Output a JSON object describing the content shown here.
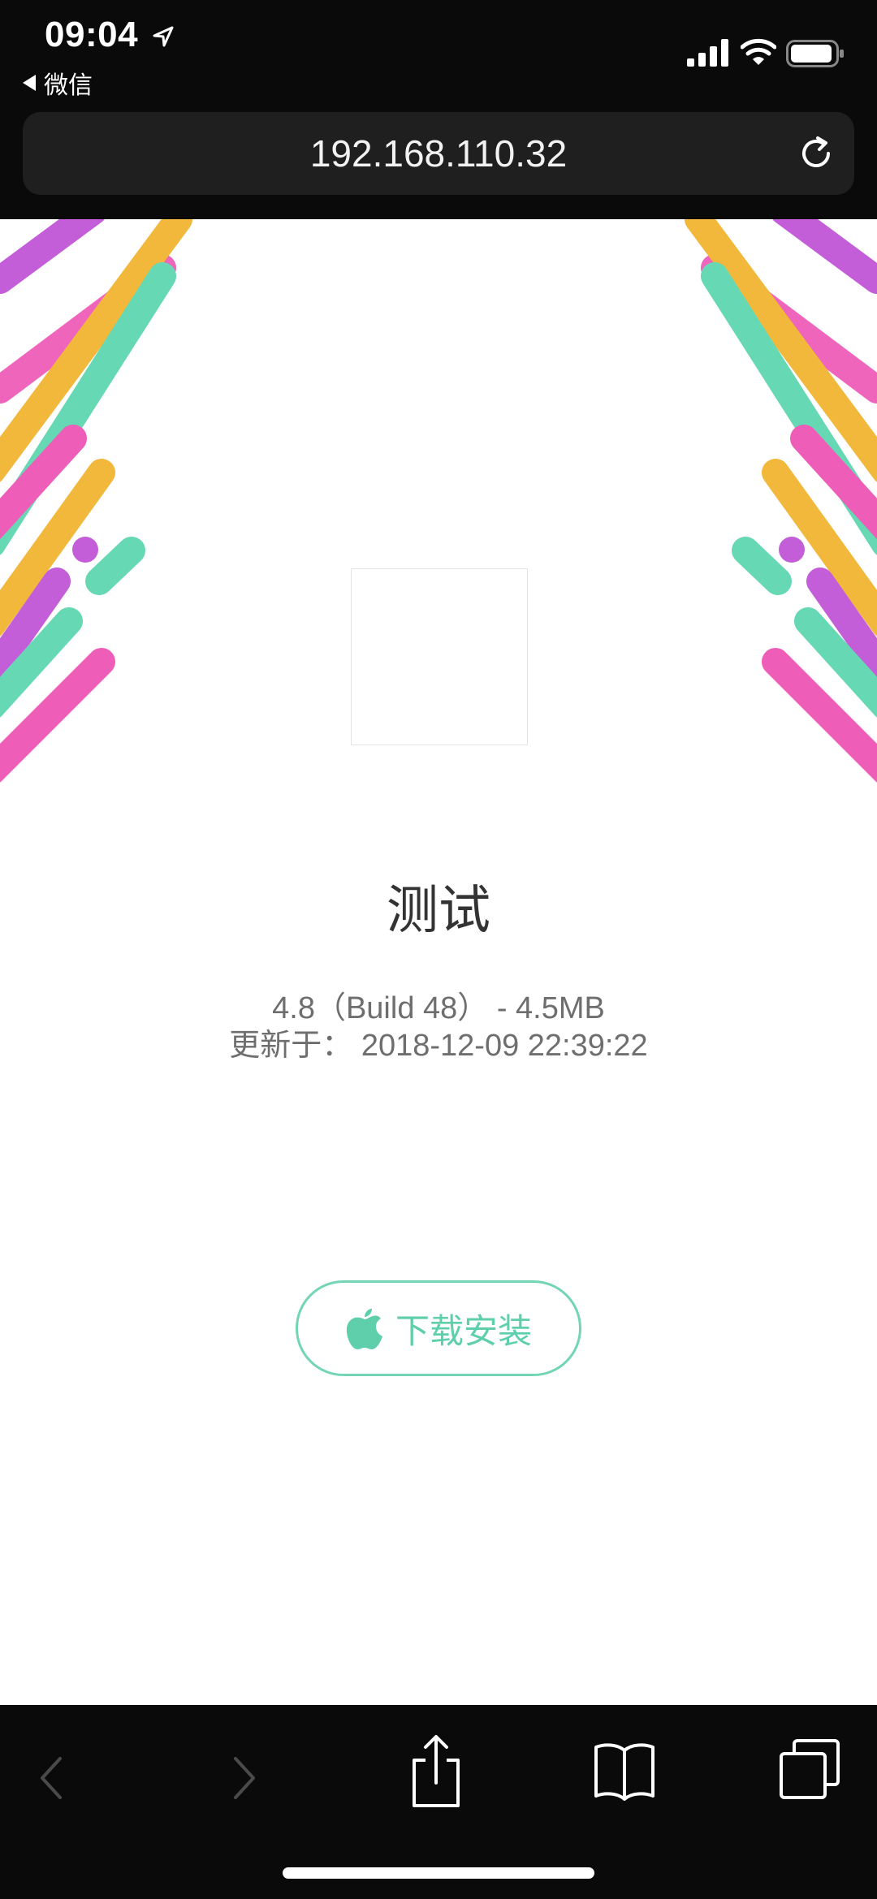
{
  "status_bar": {
    "time": "09:04",
    "back_app": "微信"
  },
  "browser": {
    "url": "192.168.110.32"
  },
  "app": {
    "name": "测试",
    "version_info": "4.8（Build 48） - 4.5MB",
    "update_info": "更新于： 2018-12-09 22:39:22",
    "install_label": "下载安装"
  },
  "colors": {
    "accent": "#5ecfaa",
    "stripe_pink": "#ee5db8",
    "stripe_yellow": "#f2b83c",
    "stripe_green": "#66d8b4",
    "stripe_purple": "#c45ed8"
  },
  "icons": {
    "install": "apple-icon",
    "toolbar": [
      "back-arrow-icon",
      "forward-arrow-icon",
      "share-icon",
      "bookmarks-icon",
      "tabs-icon"
    ]
  }
}
